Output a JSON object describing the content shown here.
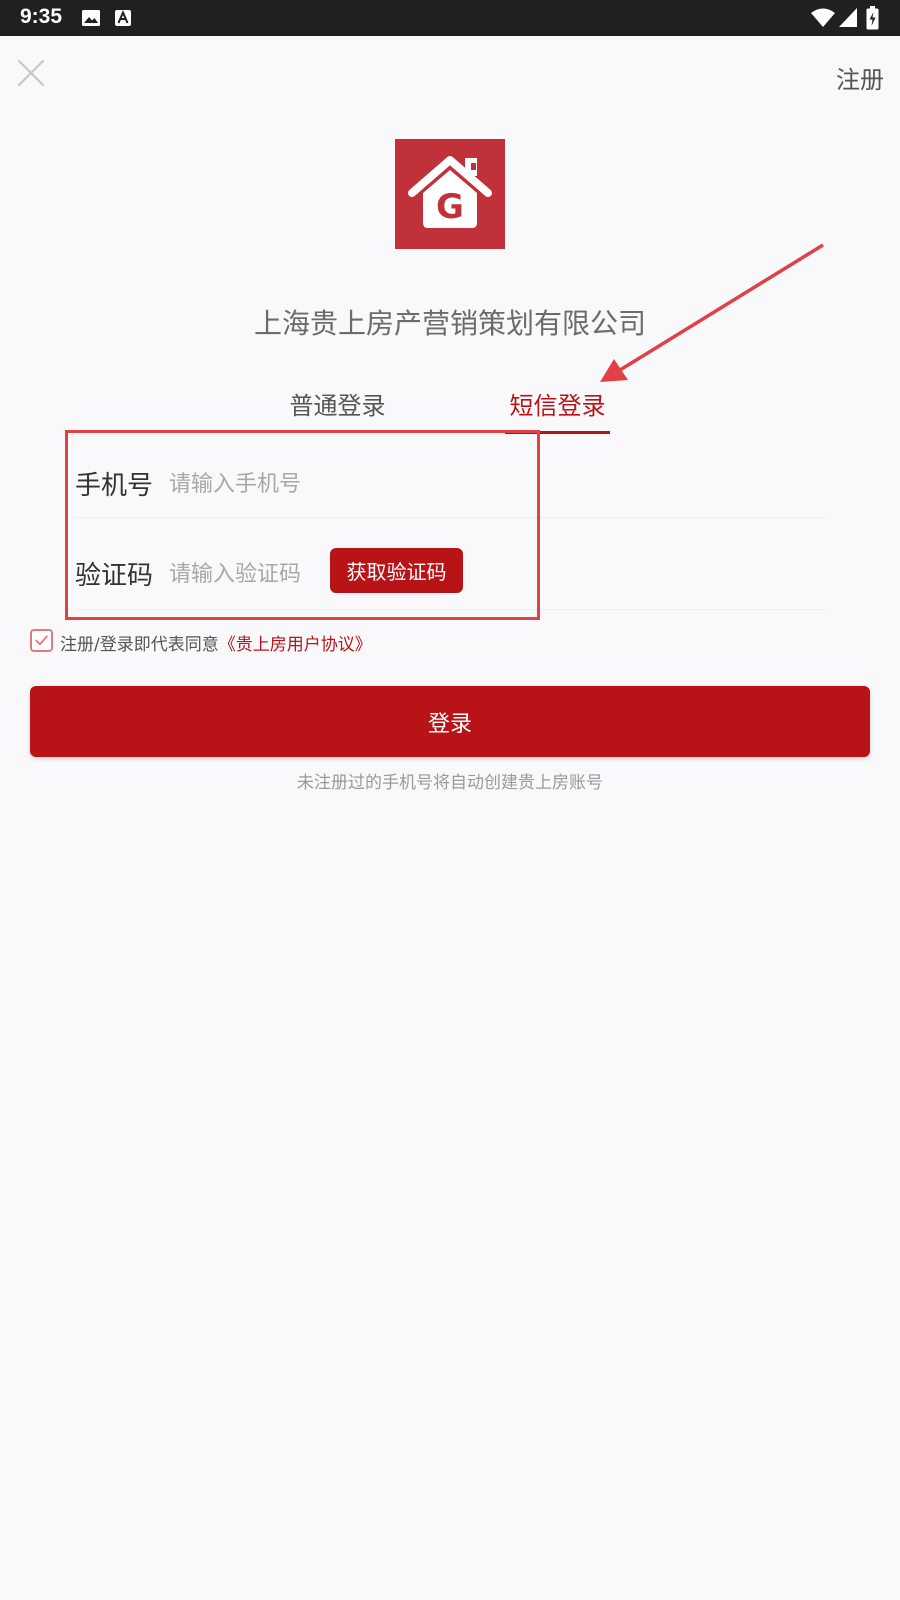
{
  "status_bar": {
    "time": "9:35",
    "icons": [
      "image-icon",
      "text-a-icon",
      "wifi-icon",
      "signal-icon",
      "battery-charging-icon"
    ]
  },
  "header": {
    "close_icon": "close-icon",
    "register_label": "注册"
  },
  "logo": {
    "letter": "G",
    "icon": "house-logo-icon",
    "color": "#c1313a"
  },
  "company_name": "上海贵上房产营销策划有限公司",
  "tabs": [
    {
      "label": "普通登录",
      "active": false
    },
    {
      "label": "短信登录",
      "active": true
    }
  ],
  "form": {
    "phone": {
      "label": "手机号",
      "placeholder": "请输入手机号",
      "value": ""
    },
    "code": {
      "label": "验证码",
      "placeholder": "请输入验证码",
      "value": "",
      "get_code_label": "获取验证码"
    }
  },
  "agreement": {
    "checked": true,
    "text": "注册/登录即代表同意",
    "link": "《贵上房用户协议》"
  },
  "login_button": "登录",
  "note": "未注册过的手机号将自动创建贵上房账号",
  "colors": {
    "accent": "#b81317",
    "annotation": "#e04048",
    "background": "#f9f9fb"
  }
}
